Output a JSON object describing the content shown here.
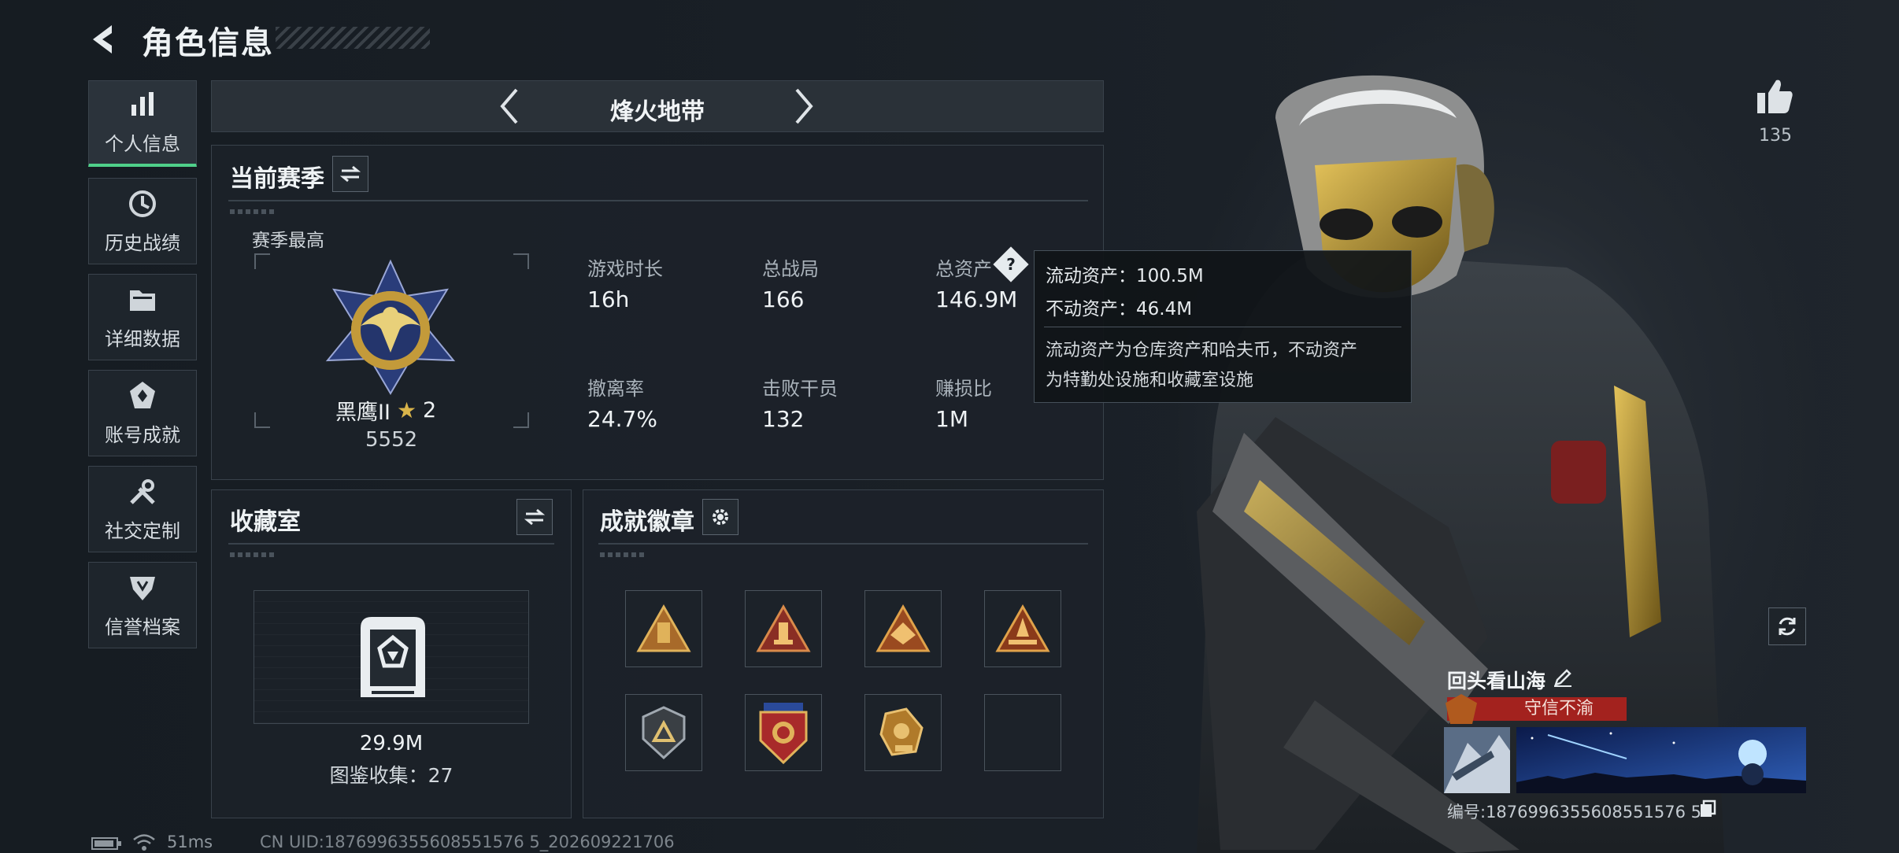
{
  "header": {
    "title": "角色信息"
  },
  "sidebar": {
    "items": [
      {
        "label": "个人信息",
        "icon": "bar-chart-icon"
      },
      {
        "label": "历史战绩",
        "icon": "history-icon"
      },
      {
        "label": "详细数据",
        "icon": "folder-icon"
      },
      {
        "label": "账号成就",
        "icon": "achievement-icon"
      },
      {
        "label": "社交定制",
        "icon": "tools-icon"
      },
      {
        "label": "信誉档案",
        "icon": "credit-shield-icon"
      }
    ]
  },
  "mode_nav": {
    "title": "烽火地带"
  },
  "season": {
    "title": "当前赛季",
    "best_label": "赛季最高",
    "rank_name": "黑鹰II",
    "rank_stars": "2",
    "rank_score": "5552",
    "stats": [
      {
        "label": "游戏时长",
        "value": "16h"
      },
      {
        "label": "总战局",
        "value": "166"
      },
      {
        "label": "总资产",
        "value": "146.9M"
      },
      {
        "label": "撤离率",
        "value": "24.7%"
      },
      {
        "label": "击败干员",
        "value": "132"
      },
      {
        "label": "赚损比",
        "value": "1M"
      }
    ],
    "help_glyph": "?"
  },
  "tooltip": {
    "liquid": "流动资产：100.5M",
    "fixed": "不动资产：46.4M",
    "desc_line1": "流动资产为仓库资产和哈夫币，不动资产",
    "desc_line2": "为特勤处设施和收藏室设施"
  },
  "collection": {
    "title": "收藏室",
    "value": "29.9M",
    "catalog": "图鉴收集：27"
  },
  "badges": {
    "title": "成就徽章"
  },
  "likes": {
    "count": "135"
  },
  "player": {
    "name": "回头看山海",
    "title_badge": "守信不渝",
    "id_text": "编号:1876996355608551576 5"
  },
  "status_bar": {
    "latency": "51ms",
    "uid": "CN UID:1876996355608551576 5_202609221706"
  },
  "colors": {
    "accent_green": "#4fd08a",
    "badge_red": "#a3221e",
    "gold": "#c9a227"
  }
}
